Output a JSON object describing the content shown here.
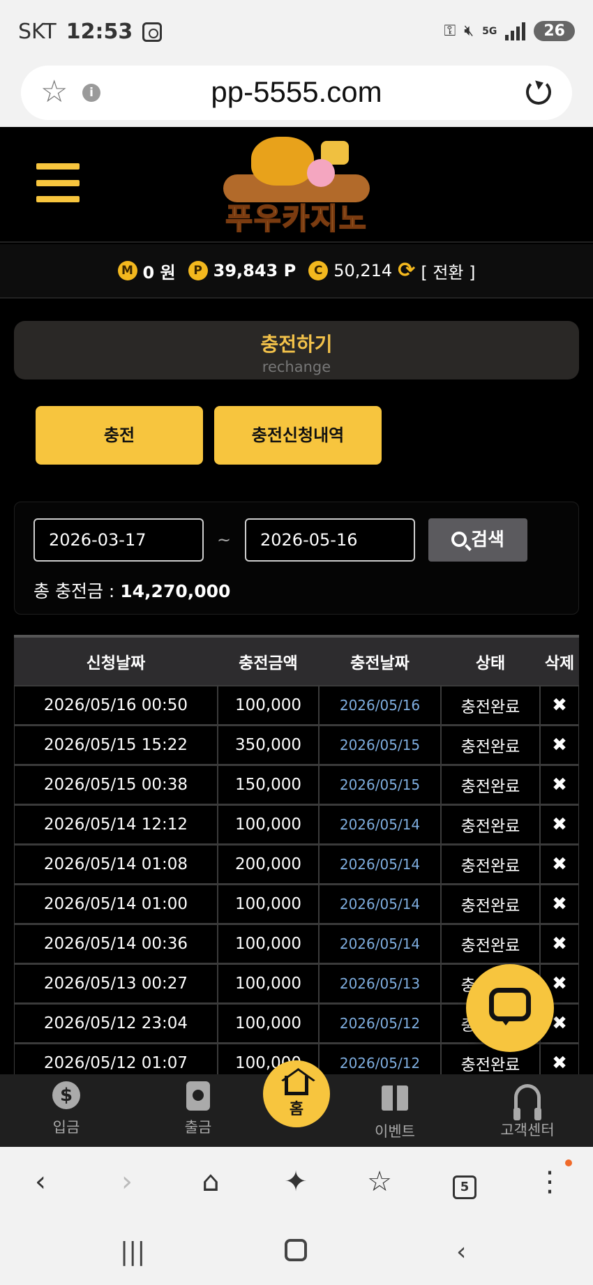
{
  "status": {
    "carrier": "SKT",
    "time": "12:53",
    "network": "5G",
    "battery": "26"
  },
  "browser": {
    "url": "pp-5555.com",
    "tab_count": "5"
  },
  "site": {
    "logo_text": "푸우카지노"
  },
  "balance": {
    "m_label": "M",
    "m_value": "0 원",
    "p_label": "P",
    "p_value": "39,843 P",
    "c_label": "C",
    "c_value": "50,214",
    "convert": "[ 전환 ]"
  },
  "title": {
    "main": "충전하기",
    "sub": "rechange"
  },
  "tabs": {
    "charge": "충전",
    "history": "충전신청내역"
  },
  "search": {
    "start_date": "2026-03-17",
    "end_date": "2026-05-16",
    "tilde": "~",
    "button": "검색",
    "total_label": "총 충전금 : ",
    "total_value": "14,270,000"
  },
  "table": {
    "headers": [
      "신청날짜",
      "충전금액",
      "충전날짜",
      "상태",
      "삭제"
    ],
    "rows": [
      {
        "req": "2026/05/16 00:50",
        "amount": "100,000",
        "date": "2026/05/16",
        "status": "충전완료",
        "del": "✖"
      },
      {
        "req": "2026/05/15 15:22",
        "amount": "350,000",
        "date": "2026/05/15",
        "status": "충전완료",
        "del": "✖"
      },
      {
        "req": "2026/05/15 00:38",
        "amount": "150,000",
        "date": "2026/05/15",
        "status": "충전완료",
        "del": "✖"
      },
      {
        "req": "2026/05/14 12:12",
        "amount": "100,000",
        "date": "2026/05/14",
        "status": "충전완료",
        "del": "✖"
      },
      {
        "req": "2026/05/14 01:08",
        "amount": "200,000",
        "date": "2026/05/14",
        "status": "충전완료",
        "del": "✖"
      },
      {
        "req": "2026/05/14 01:00",
        "amount": "100,000",
        "date": "2026/05/14",
        "status": "충전완료",
        "del": "✖"
      },
      {
        "req": "2026/05/14 00:36",
        "amount": "100,000",
        "date": "2026/05/14",
        "status": "충전완료",
        "del": "✖"
      },
      {
        "req": "2026/05/13 00:27",
        "amount": "100,000",
        "date": "2026/05/13",
        "status": "충전완료",
        "del": "✖"
      },
      {
        "req": "2026/05/12 23:04",
        "amount": "100,000",
        "date": "2026/05/12",
        "status": "충전완료",
        "del": "✖"
      },
      {
        "req": "2026/05/12 01:07",
        "amount": "100,000",
        "date": "2026/05/12",
        "status": "충전완료",
        "del": "✖"
      }
    ]
  },
  "bottom_nav": {
    "deposit": "입금",
    "withdraw": "출금",
    "home": "홈",
    "event": "이벤트",
    "support": "고객센터"
  },
  "icons": {
    "chat": "chat-bubble-icon",
    "search": "search-icon",
    "refresh": "swap-icon"
  },
  "colors": {
    "accent": "#f7c53e",
    "link_date": "#7faee0",
    "panel": "#2a2826"
  }
}
